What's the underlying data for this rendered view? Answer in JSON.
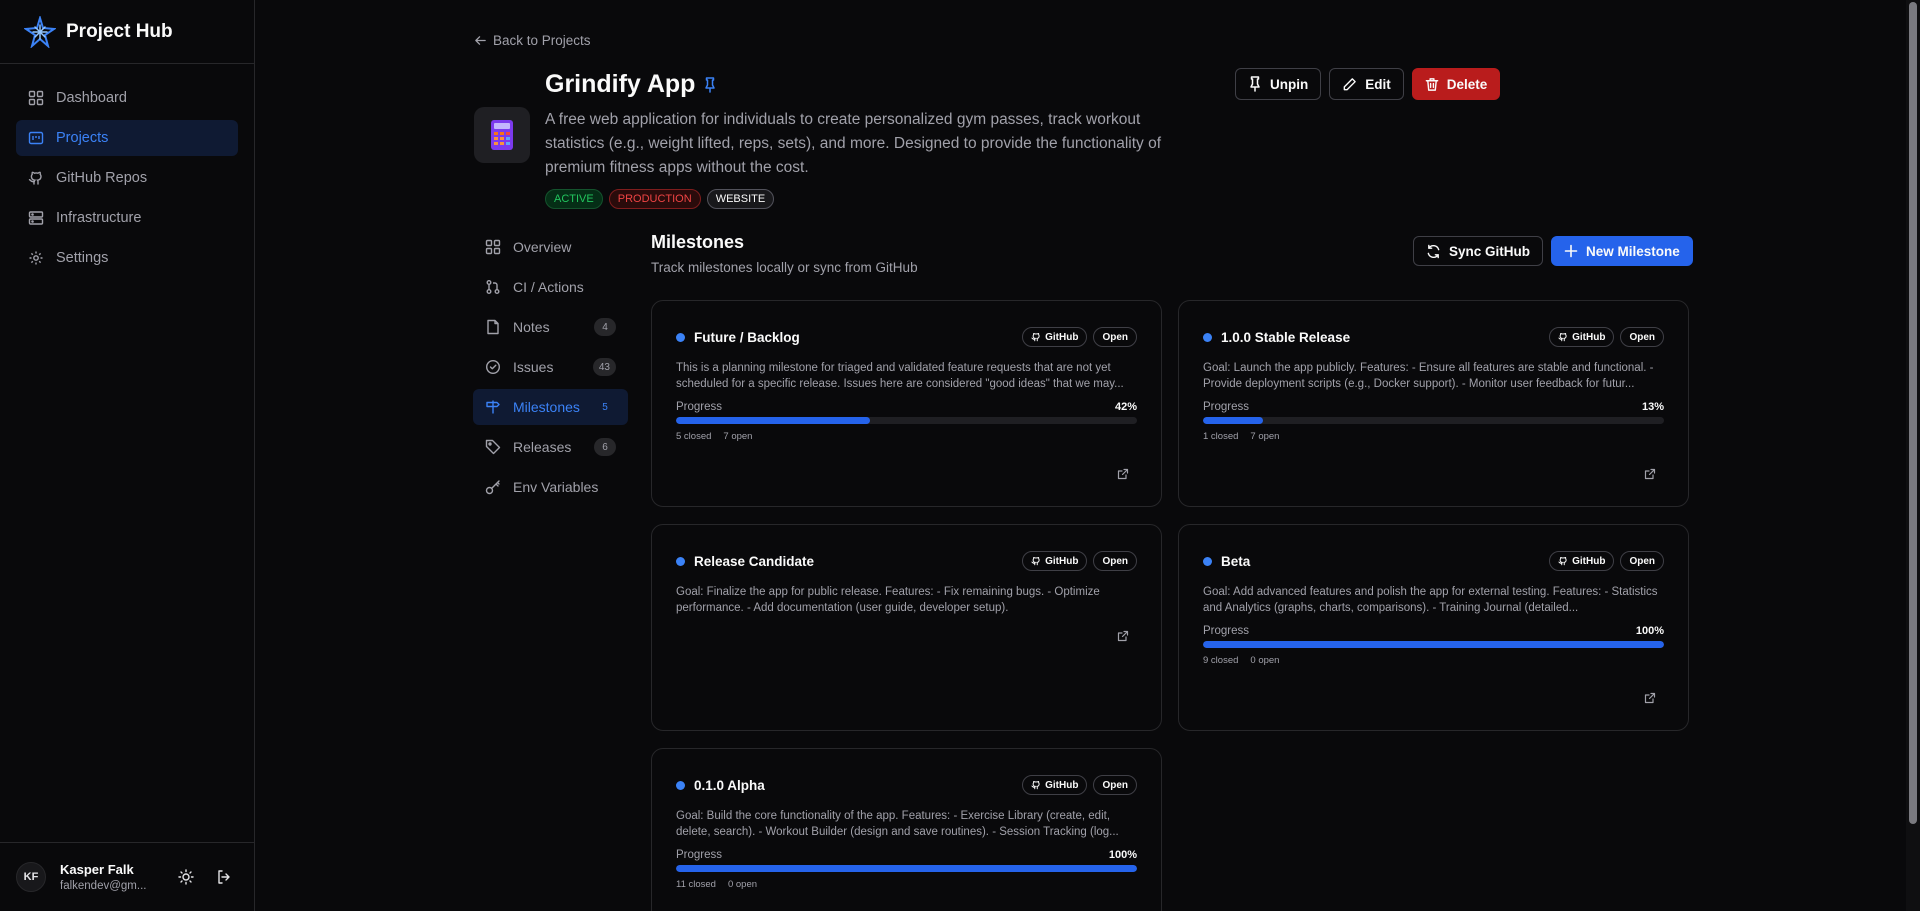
{
  "brand": {
    "title": "Project Hub"
  },
  "nav": [
    {
      "label": "Dashboard",
      "icon": "dashboard-icon"
    },
    {
      "label": "Projects",
      "icon": "projects-icon",
      "active": true
    },
    {
      "label": "GitHub Repos",
      "icon": "github-icon"
    },
    {
      "label": "Infrastructure",
      "icon": "server-icon"
    },
    {
      "label": "Settings",
      "icon": "gear-icon"
    }
  ],
  "user": {
    "initials": "KF",
    "name": "Kasper Falk",
    "email": "falkendev@gm..."
  },
  "back_label": "Back to Projects",
  "project": {
    "title": "Grindify App",
    "description": "A free web application for individuals to create personalized gym passes, track workout statistics (e.g., weight lifted, reps, sets), and more. Designed to provide the functionality of premium fitness apps without the cost.",
    "tags": [
      "ACTIVE",
      "PRODUCTION",
      "WEBSITE"
    ]
  },
  "actions": {
    "unpin": "Unpin",
    "edit": "Edit",
    "delete": "Delete"
  },
  "subnav": [
    {
      "label": "Overview",
      "icon": "grid-icon",
      "count": ""
    },
    {
      "label": "CI / Actions",
      "icon": "git-pull-icon",
      "count": ""
    },
    {
      "label": "Notes",
      "icon": "file-icon",
      "count": "4"
    },
    {
      "label": "Issues",
      "icon": "circle-check-icon",
      "count": "43"
    },
    {
      "label": "Milestones",
      "icon": "signpost-icon",
      "count": "5",
      "active": true
    },
    {
      "label": "Releases",
      "icon": "tag-icon",
      "count": "6"
    },
    {
      "label": "Env Variables",
      "icon": "key-icon",
      "count": ""
    }
  ],
  "milestones_section": {
    "title": "Milestones",
    "subtitle": "Track milestones locally or sync from GitHub",
    "sync_label": "Sync GitHub",
    "new_label": "New Milestone"
  },
  "cards": [
    {
      "title": "Future / Backlog",
      "source": "GitHub",
      "state": "Open",
      "description": "This is a planning milestone for triaged and validated feature requests that are not yet scheduled for a specific release. Issues here are considered \"good ideas\" that we may...",
      "has_progress": true,
      "progress_label": "Progress",
      "progress": 42,
      "progress_text": "42%",
      "closed": "5 closed",
      "open": "7 open"
    },
    {
      "title": "1.0.0 Stable Release",
      "source": "GitHub",
      "state": "Open",
      "description": "Goal: Launch the app publicly. Features: - Ensure all features are stable and functional. - Provide deployment scripts (e.g., Docker support). - Monitor user feedback for futur...",
      "has_progress": true,
      "progress_label": "Progress",
      "progress": 13,
      "progress_text": "13%",
      "closed": "1 closed",
      "open": "7 open"
    },
    {
      "title": "Release Candidate",
      "source": "GitHub",
      "state": "Open",
      "description": "Goal: Finalize the app for public release. Features: - Fix remaining bugs. - Optimize performance. - Add documentation (user guide, developer setup).",
      "has_progress": false
    },
    {
      "title": "Beta",
      "source": "GitHub",
      "state": "Open",
      "description": "Goal: Add advanced features and polish the app for external testing. Features: - Statistics and Analytics (graphs, charts, comparisons). - Training Journal (detailed...",
      "has_progress": true,
      "progress_label": "Progress",
      "progress": 100,
      "progress_text": "100%",
      "closed": "9 closed",
      "open": "0 open"
    },
    {
      "title": "0.1.0 Alpha",
      "source": "GitHub",
      "state": "Open",
      "description": "Goal: Build the core functionality of the app. Features: - Exercise Library (create, edit, delete, search). - Workout Builder (design and save routines). - Session Tracking (log...",
      "has_progress": true,
      "progress_label": "Progress",
      "progress": 100,
      "progress_text": "100%",
      "closed": "11 closed",
      "open": "0 open"
    }
  ],
  "colors": {
    "accent": "#2563eb",
    "danger": "#b91c1c",
    "active_tag": "#22c55e",
    "production_tag": "#ef4444"
  }
}
